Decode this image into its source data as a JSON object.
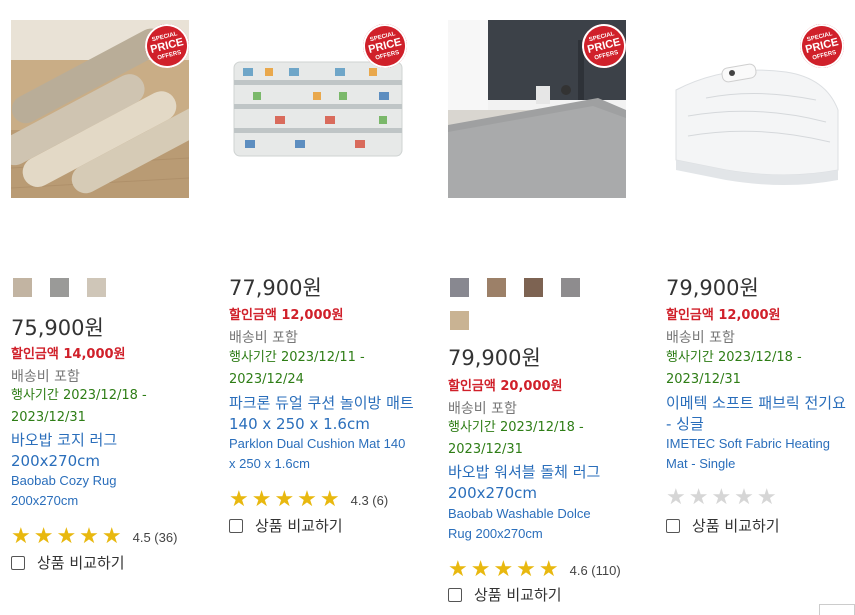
{
  "badge": {
    "line1": "SPECIAL",
    "line2": "PRICE",
    "line3": "OFFERS"
  },
  "products": [
    {
      "swatches": [
        "#c2b4a2",
        "#9a9a98",
        "#cfc6b8"
      ],
      "price": "75,900원",
      "discount": "할인금액 14,000원",
      "shipping": "배송비 포함",
      "period": "행사기간 2023/12/18 - 2023/12/31",
      "title_ko": "바오밥 코지 러그 200x270cm",
      "title_en": "Baobab Cozy Rug 200x270cm",
      "rating": 4.5,
      "stars_display": "★★★★★",
      "score": "4.5 (36)",
      "compare": "상품 비교하기",
      "image_icon": "rolled-rugs-image"
    },
    {
      "swatches": [],
      "price": "77,900원",
      "discount": "할인금액 12,000원",
      "shipping": "배송비 포함",
      "period": "행사기간 2023/12/11 - 2023/12/24",
      "title_ko": "파크론 듀얼 쿠션 놀이방 매트 140 x 250 x 1.6cm",
      "title_en": "Parklon Dual Cushion Mat 140 x 250 x 1.6cm",
      "rating": 4.3,
      "score": "4.3 (6)",
      "compare": "상품 비교하기",
      "image_icon": "play-mat-image"
    },
    {
      "swatches": [
        "#888890",
        "#9c8068",
        "#7d6352",
        "#8e8c8e",
        "#c9b393"
      ],
      "price": "79,900원",
      "discount": "할인금액 20,000원",
      "shipping": "배송비 포함",
      "period": "행사기간 2023/12/18 - 2023/12/31",
      "title_ko": "바오밥 워셔블 돌체 러그 200x270cm",
      "title_en": "Baobab Washable Dolce Rug 200x270cm",
      "rating": 4.6,
      "score": "4.6 (110)",
      "compare": "상품 비교하기",
      "image_icon": "grey-rug-room-image"
    },
    {
      "swatches": [],
      "price": "79,900원",
      "discount": "할인금액 12,000원",
      "shipping": "배송비 포함",
      "period": "행사기간 2023/12/18 - 2023/12/31",
      "title_ko": "이메텍 소프트 패브릭 전기요 - 싱글",
      "title_en": "IMETEC Soft Fabric Heating Mat - Single",
      "rating": 0,
      "score": "",
      "compare": "상품 비교하기",
      "image_icon": "heating-mat-image"
    }
  ]
}
